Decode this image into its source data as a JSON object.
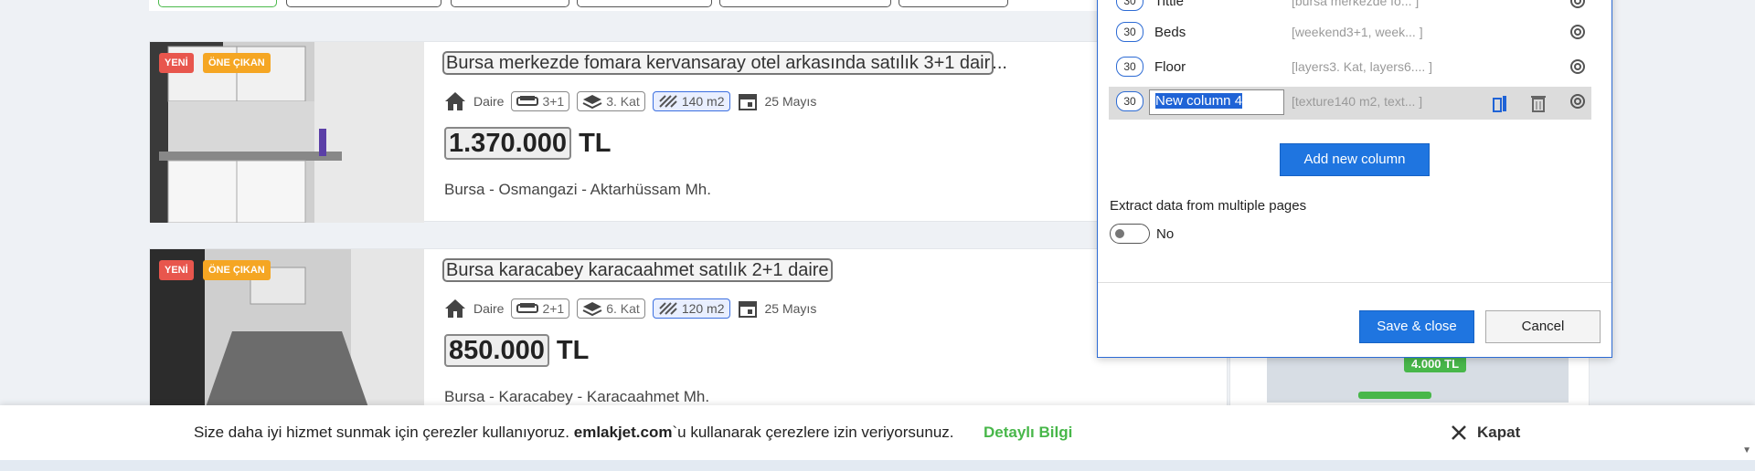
{
  "listings": [
    {
      "badge_new": "YENİ",
      "badge_featured": "ÖNE ÇIKAN",
      "title": "Bursa merkezde fomara kervansaray otel arkasında satılık 3+1 dair",
      "title_ellipsis": "...",
      "type": "Daire",
      "rooms": "3+1",
      "floor": "3. Kat",
      "area": "140 m2",
      "date": "25 Mayıs",
      "price": "1.370.000",
      "currency": "TL",
      "location": "Bursa - Osmangazi - Aktarhüssam Mh."
    },
    {
      "badge_new": "YENİ",
      "badge_featured": "ÖNE ÇIKAN",
      "title": "Bursa karacabey karacaahmet satılık 2+1 daire",
      "title_ellipsis": "",
      "type": "Daire",
      "rooms": "2+1",
      "floor": "6. Kat",
      "area": "120 m2",
      "date": "25 Mayıs",
      "price": "850.000",
      "currency": "TL",
      "location": "Bursa - Karacabey - Karacaahmet Mh."
    }
  ],
  "map": {
    "pin_price": "4.000 TL"
  },
  "dialog": {
    "columns": [
      {
        "count": "30",
        "name": "Tittle",
        "preview": "[bursa merkezde fo... ]"
      },
      {
        "count": "30",
        "name": "Beds",
        "preview": "[weekend3+1, week... ]"
      },
      {
        "count": "30",
        "name": "Floor",
        "preview": "[layers3. Kat, layers6.... ]"
      },
      {
        "count": "30",
        "name": "New column 4",
        "preview": "[texture140 m2, text... ]"
      }
    ],
    "add_column_label": "Add new column",
    "multi_pages_label": "Extract data from multiple pages",
    "multi_pages_value": "No",
    "save_label": "Save & close",
    "cancel_label": "Cancel"
  },
  "cookie": {
    "text_before": "Size daha iyi hizmet sunmak için çerezler kullanıyoruz.",
    "brand": "emlakjet.com",
    "text_after": "`u kullanarak çerezlere izin veriyorsunuz.",
    "details_link": "Detaylı Bilgi",
    "close_label": "Kapat"
  },
  "colors": {
    "accent": "#1f75e0",
    "green": "#48b74a",
    "badge_red": "#e8564d",
    "badge_orange": "#f5a623"
  }
}
